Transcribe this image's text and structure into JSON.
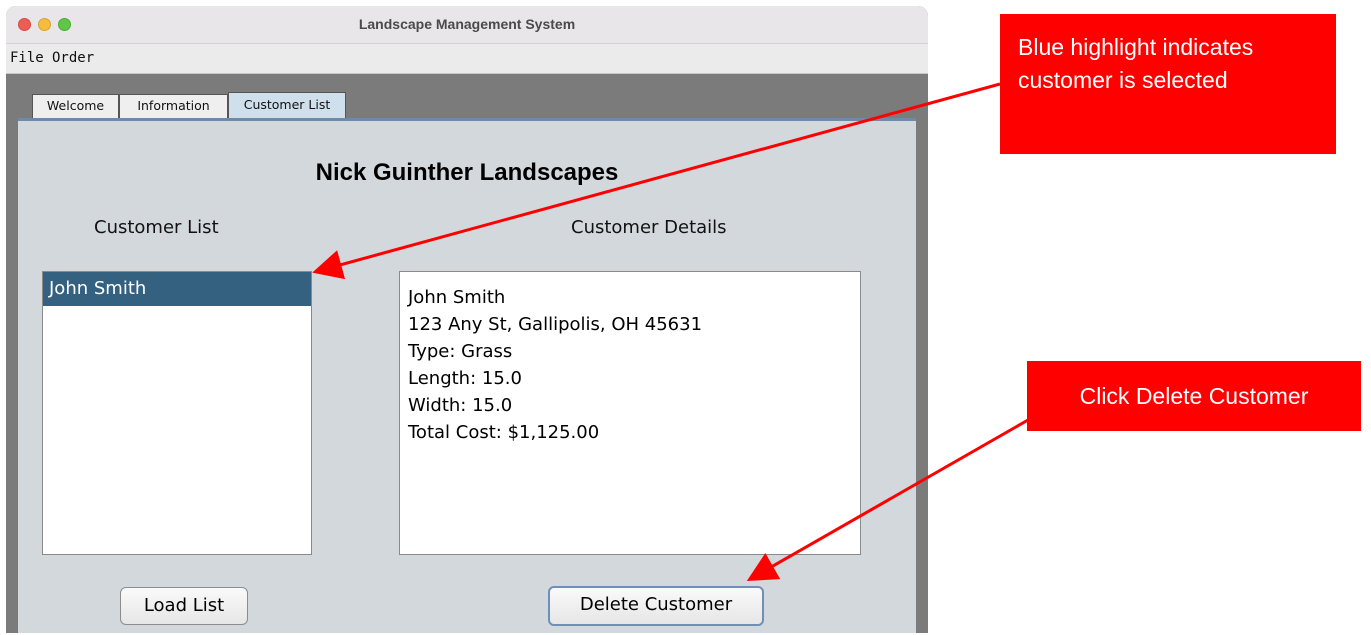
{
  "window": {
    "title": "Landscape Management System"
  },
  "menu": {
    "items": [
      {
        "id": "file",
        "label": "File"
      },
      {
        "id": "order",
        "label": "Order"
      }
    ]
  },
  "tabs": [
    {
      "id": "welcome",
      "label": "Welcome",
      "active": false
    },
    {
      "id": "information",
      "label": "Information",
      "active": false
    },
    {
      "id": "customer-list",
      "label": "Customer List",
      "active": true
    }
  ],
  "panel": {
    "company_name": "Nick Guinther Landscapes",
    "list_label": "Customer List",
    "details_label": "Customer Details",
    "customers": [
      "John Smith"
    ],
    "selected_customer": "John Smith",
    "details_lines": [
      "John Smith",
      "123 Any St, Gallipolis, OH 45631",
      "Type: Grass",
      "Length: 15.0",
      "Width: 15.0",
      "Total Cost: $1,125.00"
    ],
    "load_button": "Load List",
    "delete_button": "Delete Customer"
  },
  "annotations": {
    "selection_note": "Blue highlight indicates customer is selected",
    "delete_note": "Click Delete Customer",
    "color": "#ff0000"
  },
  "colors": {
    "selection": "#33617f",
    "panel_bg": "#d3d8dd",
    "window_gray": "#7b7b7b"
  }
}
